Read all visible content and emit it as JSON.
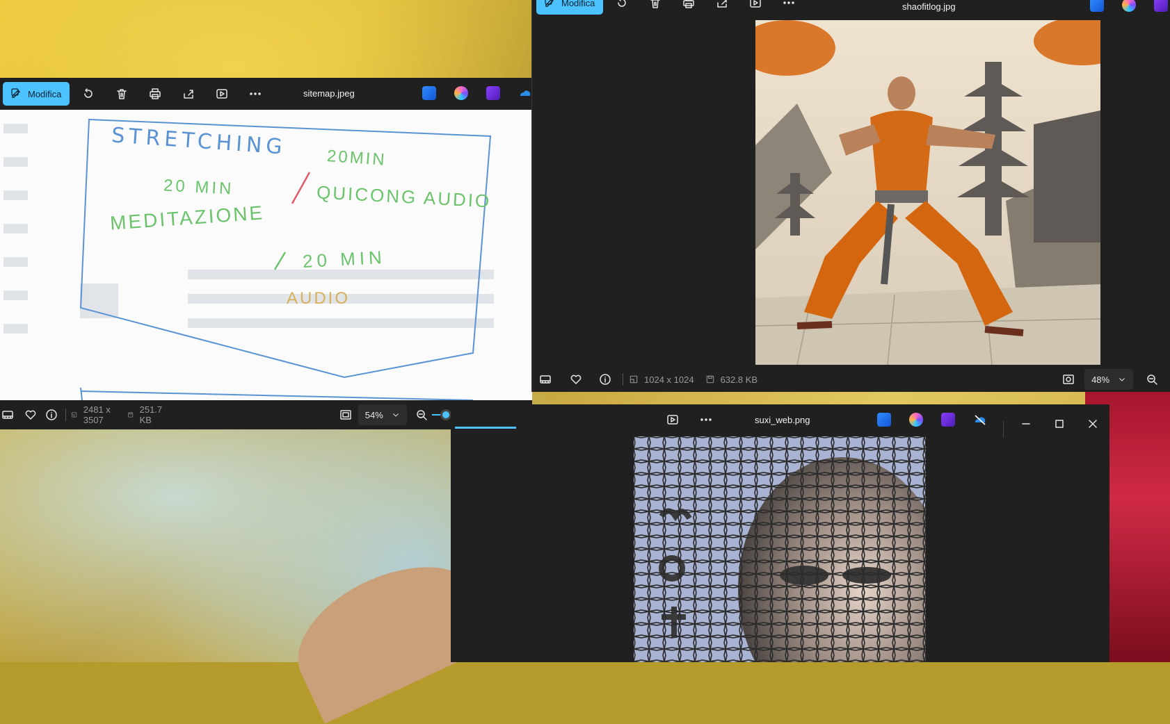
{
  "left_window": {
    "title": "sitemap.jpeg",
    "edit_label": "Modifica",
    "dimensions": "2481 x 3507",
    "file_size": "251.7 KB",
    "zoom": "54%",
    "zoom_slider_value": 0.1,
    "sketch_lines": [
      "STRETCHING",
      "20MIN",
      "20 MIN",
      "QUICONG AUDIO",
      "MEDITAZIONE",
      "20 MIN",
      "AUDIO"
    ]
  },
  "right_window": {
    "title": "shaofitlog.jpg",
    "edit_label": "Modifica",
    "dimensions": "1024 x 1024",
    "file_size": "632.8 KB",
    "zoom": "48%"
  },
  "bottom_window": {
    "title": "suxi_web.png"
  },
  "icons": {
    "rotate": "rotate-icon",
    "delete": "trash-icon",
    "print": "printer-icon",
    "share": "share-icon",
    "slideshow": "slideshow-icon",
    "more": "more-icon",
    "designer": "designer-icon",
    "clipchamp": "clipchamp-icon",
    "copilot": "copilot-icon",
    "onedrive": "onedrive-icon"
  },
  "colors": {
    "accent": "#4cc2ff",
    "window_bg": "#202020",
    "wallpaper_yellow": "#e2c14a",
    "wallpaper_red": "#b81f35"
  }
}
